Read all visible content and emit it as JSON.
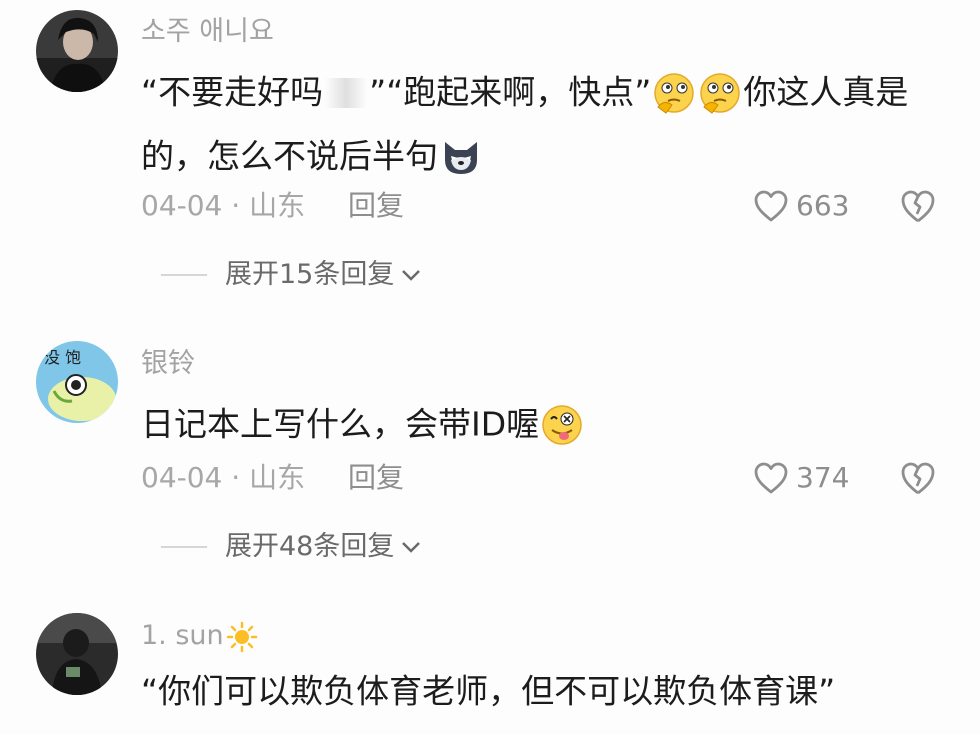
{
  "comments": [
    {
      "username": "소주 애니요",
      "text_lines": [
        "“不要走好吗",
        "”“跑起来啊，快点”",
        "你这人真是",
        "的，怎么不说后半句"
      ],
      "date": "04-04",
      "location": "山东",
      "meta_separator": "·",
      "reply_label": "回复",
      "likes": "663",
      "expand_label": "展开15条回复",
      "emojis": [
        "thinking-face",
        "thinking-face",
        "wolf-face"
      ]
    },
    {
      "username": "银铃",
      "text": "日记本上写什么，会带ID喔",
      "date": "04-04",
      "location": "山东",
      "meta_separator": "·",
      "reply_label": "回复",
      "likes": "374",
      "expand_label": "展开48条回复",
      "avatar_text": "没 饱",
      "emojis": [
        "silly-face"
      ]
    },
    {
      "username": "1. sun",
      "text": "“你们可以欺负体育老师，但不可以欺负体育课”",
      "emojis": [
        "sun"
      ]
    }
  ],
  "colors": {
    "background": "#fdfdfd",
    "text": "#1c1c1c",
    "secondary": "#a3a3a3",
    "emoji_yellow": "#fcd34d"
  }
}
